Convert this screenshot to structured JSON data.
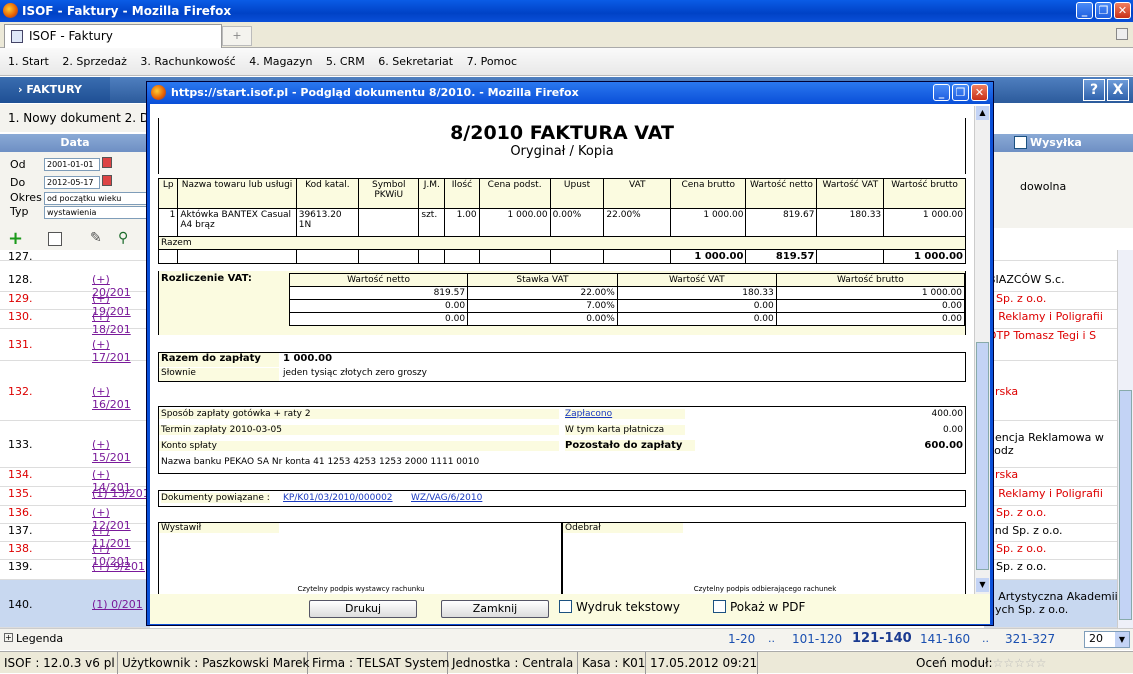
{
  "window": {
    "title": "ISOF - Faktury - Mozilla Firefox"
  },
  "tab": {
    "label": "ISOF - Faktury",
    "plus": "+"
  },
  "menu": [
    "1. Start",
    "2. Sprzedaż",
    "3. Rachunkowość",
    "4. Magazyn",
    "5. CRM",
    "6. Sekretariat",
    "7. Pomoc"
  ],
  "nav": {
    "tab": "› FAKTURY",
    "help": "?",
    "close": "X"
  },
  "sub": {
    "label": "1. Nowy dokument  2. D"
  },
  "filters": {
    "header": "Data",
    "od_label": "Od",
    "od_value": "2001-01-01",
    "do_label": "Do",
    "do_value": "2012-05-17",
    "okres_label": "Okres",
    "okres_value": "od początku wieku",
    "typ_label": "Typ",
    "typ_value": "wystawienia"
  },
  "right_header": {
    "wysylka": "Wysyłka",
    "dowolna": "dowolna"
  },
  "left_rows": [
    {
      "num": "127.",
      "link": "",
      "color": "blk",
      "top": 0
    },
    {
      "num": "128.",
      "link": "(+) 20/201",
      "color": "blk"
    },
    {
      "num": "129.",
      "link": "(+) 19/201",
      "color": "red"
    },
    {
      "num": "130.",
      "link": "(+) 18/201",
      "color": "red"
    },
    {
      "num": "131.",
      "link": "(+) 17/201",
      "color": "red"
    },
    {
      "num": "132.",
      "link": "(+) 16/201",
      "color": "red"
    },
    {
      "num": "133.",
      "link": "(+) 15/201",
      "color": "blk"
    },
    {
      "num": "134.",
      "link": "(+) 14/201",
      "color": "red"
    },
    {
      "num": "135.",
      "link": "(1) 13/201",
      "color": "red"
    },
    {
      "num": "136.",
      "link": "(+) 12/201",
      "color": "red"
    },
    {
      "num": "137.",
      "link": "(+) 11/201",
      "color": "blk"
    },
    {
      "num": "138.",
      "link": "(+) 10/201",
      "color": "red"
    },
    {
      "num": "139.",
      "link": "(+) 9/201",
      "color": "blk"
    },
    {
      "num": "140.",
      "link": "(1) 0/201",
      "color": "blk"
    }
  ],
  "right_rows": [
    "",
    "BIAZCÓW S.c.",
    "r Sp. z o.o.",
    "a Reklamy i Poligrafii",
    "DTP Tomasz Tegi i S",
    "ürska",
    "gencja Reklamowa w Łodz",
    "ürska",
    "a Reklamy i Poligrafii",
    "r Sp. z o.o.",
    "and Sp. z o.o.",
    "r Sp. z o.o.",
    "r Sp. z o.o.",
    "a Artystyczna Akademii nych Sp. z o.o."
  ],
  "bottom": {
    "legenda": "Legenda",
    "pages": [
      "1-20",
      "..",
      "101-120",
      "121-140",
      "141-160",
      "..",
      "321-327"
    ],
    "per_page": "20"
  },
  "status": {
    "version": "ISOF : 12.0.3 v6 pl",
    "user": "Użytkownik : Paszkowski Marek",
    "firma": "Firma : TELSAT System",
    "jednostka": "Jednostka : Centrala",
    "kasa": "Kasa : K01",
    "datetime": "17.05.2012 09:21",
    "ocen": "Oceń moduł:"
  },
  "popup": {
    "title": "https://start.isof.pl - Podgląd dokumentu 8/2010. - Mozilla Firefox",
    "doc_title": "8/2010 FAKTURA VAT",
    "doc_subtitle": "Oryginał / Kopia",
    "item_headers": [
      "Lp",
      "Nazwa towaru lub usługi",
      "Kod katal.",
      "Symbol PKWiU",
      "J.M.",
      "Ilość",
      "Cena podst.",
      "Upust",
      "VAT",
      "Cena brutto",
      "Wartość netto",
      "Wartość VAT",
      "Wartość brutto"
    ],
    "item_row": [
      "1",
      "Aktówka BANTEX Casual A4 brąz",
      "39613.20 1N",
      "",
      "szt.",
      "1.00",
      "1 000.00",
      "0.00%",
      "22.00%",
      "1 000.00",
      "819.67",
      "180.33",
      "1 000.00"
    ],
    "razem_label": "Razem",
    "razem_values": [
      "1 000.00",
      "819.57",
      "1 000.00"
    ],
    "vat_label": "Rozliczenie VAT:",
    "vat_headers": [
      "Wartość netto",
      "Stawka VAT",
      "Wartość VAT",
      "Wartość brutto"
    ],
    "vat_rows": [
      [
        "819.57",
        "22.00%",
        "180.33",
        "1 000.00"
      ],
      [
        "0.00",
        "7.00%",
        "0.00",
        "0.00"
      ],
      [
        "0.00",
        "0.00%",
        "0.00",
        "0.00"
      ]
    ],
    "razem_zaplaty_label": "Razem do zapłaty",
    "razem_zaplaty_value": "1 000.00",
    "slownie_label": "Słownie",
    "slownie_value": "jeden tysiąc złotych zero groszy",
    "sposob": "Sposób zapłaty gotówka + raty 2",
    "termin": "Termin zapłaty 2010-03-05",
    "konto": "Konto spłaty",
    "bank": "Nazwa banku    PEKAO SA    Nr konta   41 1253 4253 1253 2000 1111 0010",
    "zaplacono_label": "Zapłacono",
    "zaplacono_value": "400.00",
    "karta_label": "W tym karta płatnicza",
    "karta_value": "0.00",
    "pozostalo_label": "Pozostało do zapłaty",
    "pozostalo_value": "600.00",
    "dok_label": "Dokumenty powiązane :",
    "dok_link1": "KP/K01/03/2010/000002",
    "dok_link2": "WZ/VAG/6/2010",
    "wystawil": "Wystawił",
    "odebral": "Odebrał",
    "podpis_wyst": "Czytelny podpis wystawcy rachunku",
    "podpis_odb": "Czytelny podpis odbierającego rachunek",
    "btn_drukuj": "Drukuj",
    "btn_zamknij": "Zamknij",
    "chk_tekstowy": "Wydruk tekstowy",
    "chk_pdf": "Pokaż w PDF"
  }
}
